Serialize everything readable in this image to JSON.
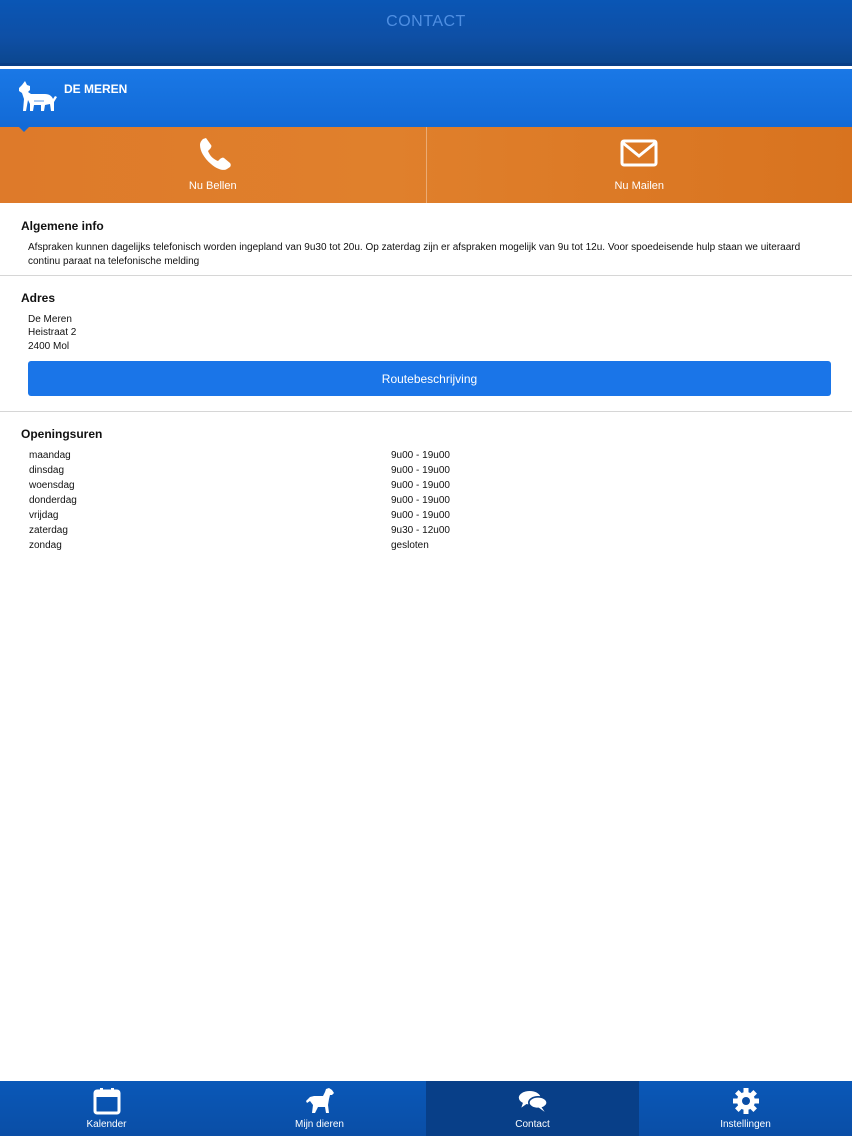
{
  "header": {
    "title": "CONTACT"
  },
  "practice": {
    "name": "DE MEREN",
    "icon": "dog-icon"
  },
  "actions": [
    {
      "label": "Nu Bellen",
      "icon": "phone-icon"
    },
    {
      "label": "Nu Mailen",
      "icon": "mail-icon"
    }
  ],
  "general": {
    "heading": "Algemene info",
    "line1": "Afspraken kunnen dagelijks telefonisch worden ingepland van 9u30 tot 20u. Op zaterdag zijn er afspraken mogelijk van 9u tot 12u. Voor spoedeisende hulp staan we uiteraard",
    "line2": "continu paraat na telefonische melding"
  },
  "address": {
    "heading": "Adres",
    "lines": [
      "De Meren",
      "Heistraat 2",
      "2400 Mol"
    ],
    "route_button": "Routebeschrijving"
  },
  "hours": {
    "heading": "Openingsuren",
    "rows": [
      {
        "day": "maandag",
        "time": "9u00 - 19u00"
      },
      {
        "day": "dinsdag",
        "time": "9u00 - 19u00"
      },
      {
        "day": "woensdag",
        "time": "9u00 - 19u00"
      },
      {
        "day": "donderdag",
        "time": "9u00 - 19u00"
      },
      {
        "day": "vrijdag",
        "time": "9u00 - 19u00"
      },
      {
        "day": "zaterdag",
        "time": "9u30 - 12u00"
      },
      {
        "day": "zondag",
        "time": "gesloten"
      }
    ]
  },
  "tabs": [
    {
      "label": "Kalender",
      "icon": "calendar-icon",
      "active": false
    },
    {
      "label": "Mijn dieren",
      "icon": "dog-icon",
      "active": false
    },
    {
      "label": "Contact",
      "icon": "chat-bubbles-icon",
      "active": true
    },
    {
      "label": "Instellingen",
      "icon": "gear-icon",
      "active": false
    }
  ],
  "colors": {
    "header_blue": "#0e4fa5",
    "practice_blue": "#126ad6",
    "action_orange": "#e0802c",
    "button_blue": "#1a75e8",
    "tab_active": "#083f88"
  }
}
